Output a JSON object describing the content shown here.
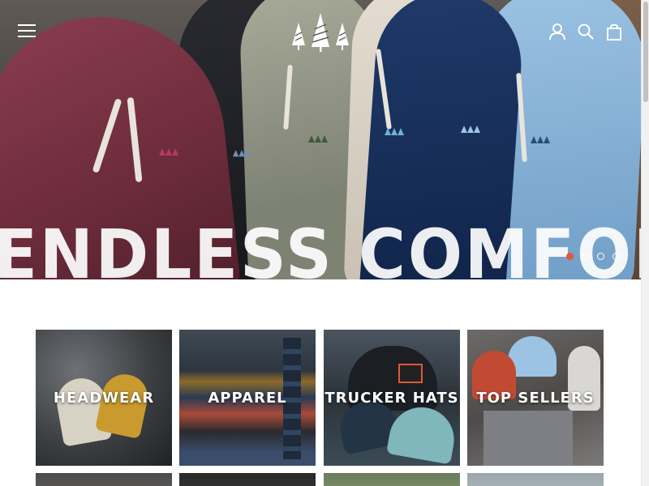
{
  "header": {
    "menu_icon": "hamburger-icon",
    "brand_icon": "three-pines-logo",
    "account_icon": "user-icon",
    "search_icon": "search-icon",
    "cart_icon": "bag-icon"
  },
  "hero": {
    "headline": "ENDLESS COMFORT",
    "slides_total": 4,
    "active_slide": 1
  },
  "categories": [
    {
      "label": "HEADWEAR"
    },
    {
      "label": "APPAREL"
    },
    {
      "label": "TRUCKER HATS"
    },
    {
      "label": "TOP SELLERS"
    }
  ],
  "colors": {
    "accent": "#e0573a",
    "text_on_image": "#ffffff"
  }
}
